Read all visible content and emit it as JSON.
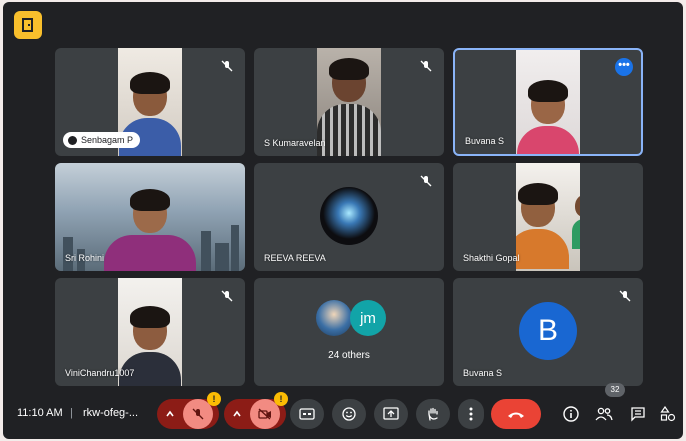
{
  "participants": [
    {
      "name": "Senbagam P",
      "muted": true
    },
    {
      "name": "S Kumaravelan",
      "muted": true
    },
    {
      "name": "Buvana S",
      "muted": false,
      "active": true
    },
    {
      "name": "Sri Rohini",
      "muted": false
    },
    {
      "name": "REEVA REEVA",
      "muted": true
    },
    {
      "name": "Shakthi Gopal",
      "muted": false
    },
    {
      "name": "ViniChandru1007",
      "muted": true
    },
    {
      "name": "Buvana S",
      "muted": true,
      "avatar_letter": "B"
    }
  ],
  "others": {
    "avatar_initials": "jm",
    "label": "24 others"
  },
  "bottom_bar": {
    "time": "11:10 AM",
    "separator": "|",
    "meeting_code": "rkw-ofeg-...",
    "warn_mic": "!",
    "warn_cam": "!",
    "people_count": "32"
  },
  "icons": {
    "logo": "exit-door-icon",
    "mic_off": "mic-off-icon",
    "cam_off": "camera-off-icon",
    "captions": "cc-icon",
    "emoji": "emoji-icon",
    "present": "present-screen-icon",
    "hand": "raise-hand-icon",
    "more": "more-vert-icon",
    "end_call": "end-call-icon",
    "info": "info-icon",
    "people": "people-icon",
    "chat": "chat-icon",
    "activities": "activities-icon"
  },
  "colors": {
    "background": "#202124",
    "tile": "#3c4043",
    "active_border": "#8ab4f8",
    "end_call": "#ea4335",
    "mic_group": "#8c1c16",
    "cam_group": "#f28b82",
    "logo": "#f9bf2c",
    "avatar_b": "#1967d2"
  }
}
